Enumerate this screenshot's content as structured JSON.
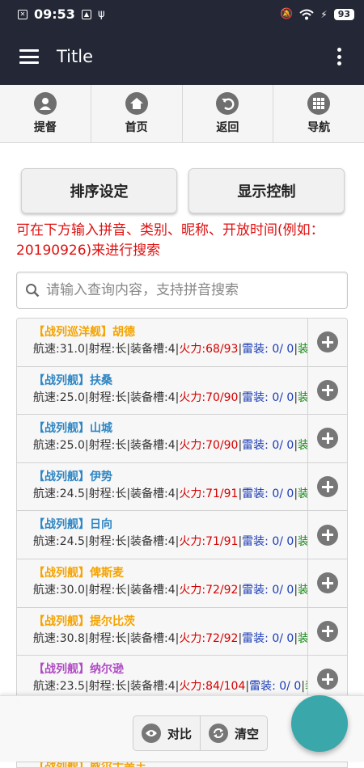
{
  "status_bar": {
    "time": "09:53",
    "battery": "93"
  },
  "app_bar": {
    "title": "Title"
  },
  "nav": [
    {
      "label": "提督",
      "icon": "user-icon"
    },
    {
      "label": "首页",
      "icon": "home-icon"
    },
    {
      "label": "返回",
      "icon": "back-icon"
    },
    {
      "label": "导航",
      "icon": "grid-icon"
    }
  ],
  "buttons": {
    "sort": "排序设定",
    "display": "显示控制"
  },
  "hint": "可在下方输入拼音、类别、昵称、开放时间(例如：20190926)来进行搜索",
  "search": {
    "placeholder": "请输入查询内容，支持拼音搜索"
  },
  "ships": [
    {
      "type": "【战列巡洋舰】",
      "name": "胡德",
      "speed": "航速:31.0",
      "range": "射程:长",
      "slots": "装备槽:4",
      "firepower": "火力:68/93",
      "torpedo": "雷装: 0/ 0",
      "equip": "装",
      "color": "#f5a300"
    },
    {
      "type": "【战列舰】",
      "name": "扶桑",
      "speed": "航速:25.0",
      "range": "射程:长",
      "slots": "装备槽:4",
      "firepower": "火力:70/90",
      "torpedo": "雷装: 0/ 0",
      "equip": "装",
      "color": "#2f86c4"
    },
    {
      "type": "【战列舰】",
      "name": "山城",
      "speed": "航速:25.0",
      "range": "射程:长",
      "slots": "装备槽:4",
      "firepower": "火力:70/90",
      "torpedo": "雷装: 0/ 0",
      "equip": "装",
      "color": "#2f86c4"
    },
    {
      "type": "【战列舰】",
      "name": "伊势",
      "speed": "航速:24.5",
      "range": "射程:长",
      "slots": "装备槽:4",
      "firepower": "火力:71/91",
      "torpedo": "雷装: 0/ 0",
      "equip": "装",
      "color": "#2f86c4"
    },
    {
      "type": "【战列舰】",
      "name": "日向",
      "speed": "航速:24.5",
      "range": "射程:长",
      "slots": "装备槽:4",
      "firepower": "火力:71/91",
      "torpedo": "雷装: 0/ 0",
      "equip": "装",
      "color": "#2f86c4"
    },
    {
      "type": "【战列舰】",
      "name": "俾斯麦",
      "speed": "航速:30.0",
      "range": "射程:长",
      "slots": "装备槽:4",
      "firepower": "火力:72/92",
      "torpedo": "雷装: 0/ 0",
      "equip": "装",
      "color": "#f5a300"
    },
    {
      "type": "【战列舰】",
      "name": "提尔比茨",
      "speed": "航速:30.8",
      "range": "射程:长",
      "slots": "装备槽:4",
      "firepower": "火力:72/92",
      "torpedo": "雷装: 0/ 0",
      "equip": "装",
      "color": "#f5a300"
    },
    {
      "type": "【战列舰】",
      "name": "纳尔逊",
      "speed": "航速:23.5",
      "range": "射程:长",
      "slots": "装备槽:4",
      "firepower": "火力:84/104",
      "torpedo": "雷装: 0/ 0",
      "equip": "装",
      "color": "#b04cc4"
    }
  ],
  "peek_item": {
    "type": "【战列舰】",
    "name": "威尔士亲王",
    "color": "#f5a300"
  },
  "bottom": {
    "compare": "对比",
    "clear": "清空"
  },
  "colors": {
    "appbar": "#232736",
    "fab": "#3aa7aa",
    "hint": "#e01010",
    "firepower": "#d50000",
    "torpedo": "#1a3bb5",
    "equip": "#1a8a1a"
  }
}
